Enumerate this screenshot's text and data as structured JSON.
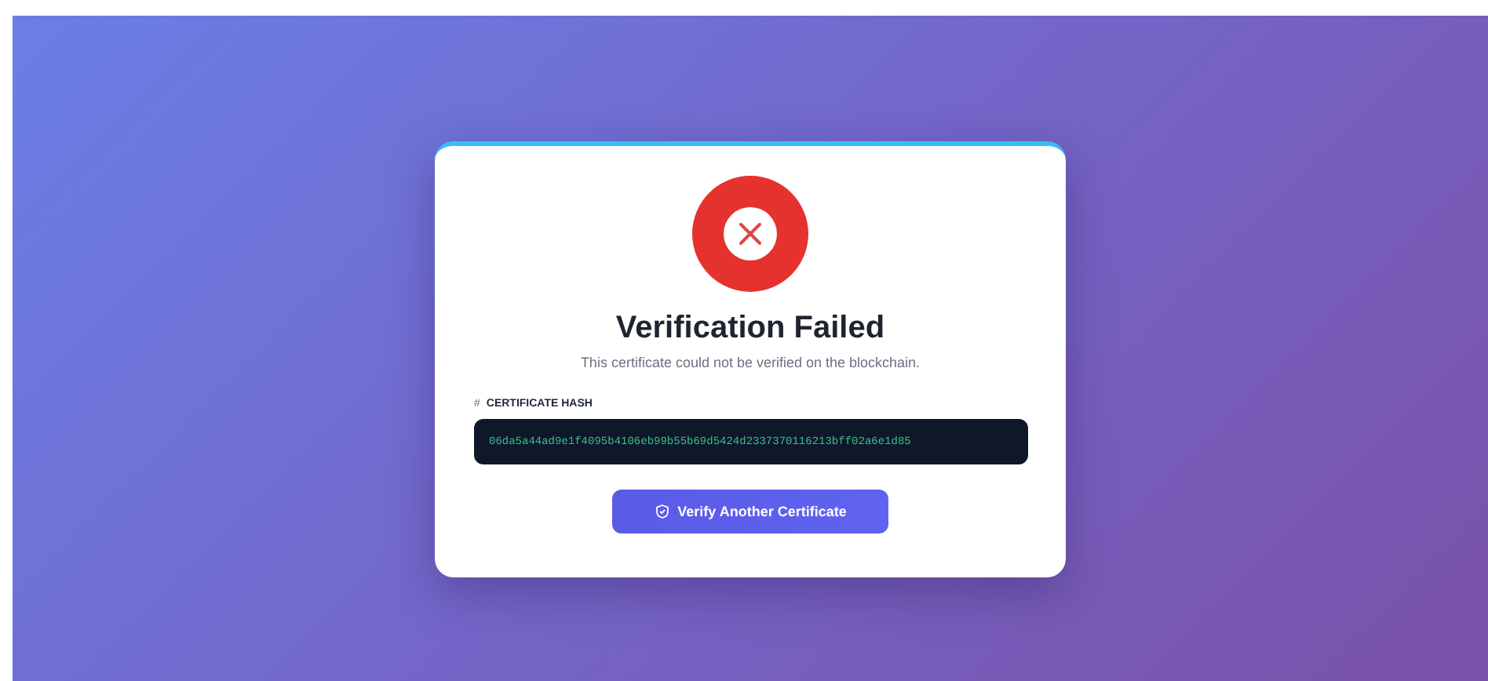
{
  "result": {
    "title": "Verification Failed",
    "message": "This certificate could not be verified on the blockchain."
  },
  "hash": {
    "icon": "#",
    "label": "CERTIFICATE HASH",
    "value": "06da5a44ad9e1f4095b4106eb99b55b69d5424d2337370116213bff02a6e1d85"
  },
  "button": {
    "label": "Verify Another Certificate"
  }
}
